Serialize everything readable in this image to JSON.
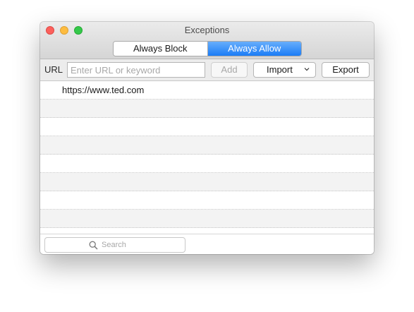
{
  "window": {
    "title": "Exceptions"
  },
  "segments": {
    "left_label": "Always Block",
    "right_label": "Always Allow",
    "selected": "Always Allow"
  },
  "toolbar": {
    "url_label": "URL",
    "url_placeholder": "Enter URL or keyword",
    "url_value": "",
    "add_label": "Add",
    "import_label": "Import",
    "export_label": "Export"
  },
  "list": {
    "rows": [
      "https://www.ted.com",
      "",
      "",
      "",
      "",
      "",
      "",
      ""
    ]
  },
  "search": {
    "placeholder": "Search",
    "value": ""
  },
  "icons": {
    "import_chevron": "chevron-down-icon",
    "search": "search-icon"
  },
  "colors": {
    "accent": "#1a7cf6",
    "close": "#fc605c",
    "minimize": "#fdbc40",
    "zoom": "#34c84a"
  }
}
